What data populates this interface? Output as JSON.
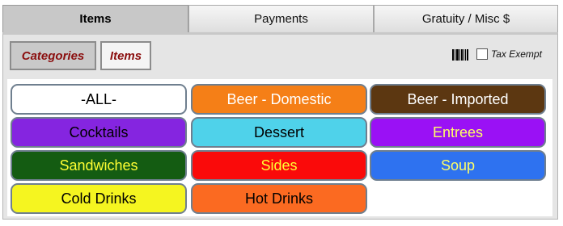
{
  "tabs": [
    {
      "label": "Items",
      "active": true
    },
    {
      "label": "Payments",
      "active": false
    },
    {
      "label": "Gratuity / Misc $",
      "active": false
    }
  ],
  "toolbar": {
    "categories_label": "Categories",
    "items_label": "Items",
    "barcode_icon": "barcode-icon",
    "tax_exempt_label": "Tax Exempt",
    "tax_exempt_checked": false
  },
  "categories": [
    {
      "label": "-ALL-",
      "bg": "#ffffff",
      "fg": "#000000"
    },
    {
      "label": "Beer - Domestic",
      "bg": "#f57f17",
      "fg": "#ffffff"
    },
    {
      "label": "Beer - Imported",
      "bg": "#5c3711",
      "fg": "#ffffff"
    },
    {
      "label": "Cocktails",
      "bg": "#8525e0",
      "fg": "#000000"
    },
    {
      "label": "Dessert",
      "bg": "#4fd2ea",
      "fg": "#000000"
    },
    {
      "label": "Entrees",
      "bg": "#9a11f5",
      "fg": "#ffff66"
    },
    {
      "label": "Sandwiches",
      "bg": "#145c12",
      "fg": "#ffff33"
    },
    {
      "label": "Sides",
      "bg": "#fa0a0a",
      "fg": "#ffff33"
    },
    {
      "label": "Soup",
      "bg": "#2e72f0",
      "fg": "#ffff66"
    },
    {
      "label": "Cold Drinks",
      "bg": "#f5f520",
      "fg": "#000000"
    },
    {
      "label": "Hot Drinks",
      "bg": "#fb6a21",
      "fg": "#000000"
    }
  ]
}
